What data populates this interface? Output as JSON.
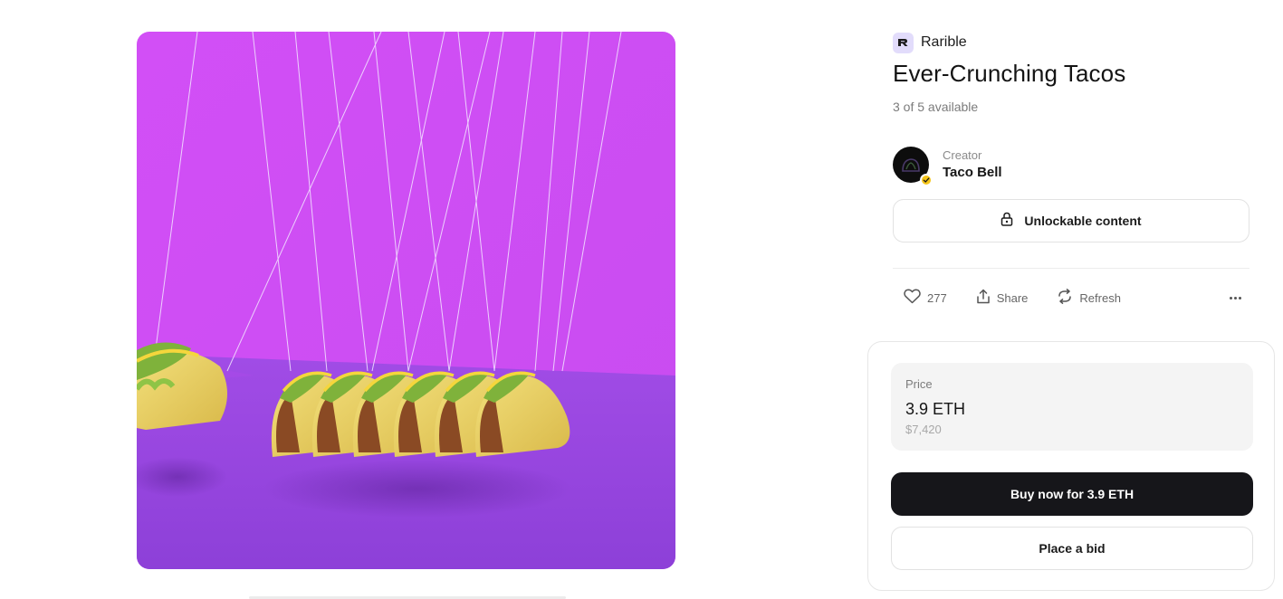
{
  "brand": {
    "name": "Rarible",
    "icon": "rarible-logo-icon"
  },
  "item": {
    "title": "Ever-Crunching Tacos",
    "availability": "3 of 5 available",
    "artwork_description_icon": "taco-artwork"
  },
  "creator": {
    "role_label": "Creator",
    "name": "Taco Bell",
    "badge": "verified-badge-icon"
  },
  "unlockable": {
    "label": "Unlockable content",
    "icon": "lock-icon"
  },
  "actions": {
    "likes_count": "277",
    "share_label": "Share",
    "refresh_label": "Refresh",
    "more_icon": "more-dots-icon"
  },
  "purchase": {
    "price_label": "Price",
    "price_eth": "3.9 ETH",
    "price_usd": "$7,420",
    "buy_label": "Buy now for 3.9 ETH",
    "bid_label": "Place a bid"
  },
  "colors": {
    "artwork_wall": "#d452f7",
    "artwork_floor": "#9a48e0",
    "buy_button": "#16161a",
    "verified_badge": "#f5c518",
    "brand_logo_bg": "#e2dcfb"
  }
}
